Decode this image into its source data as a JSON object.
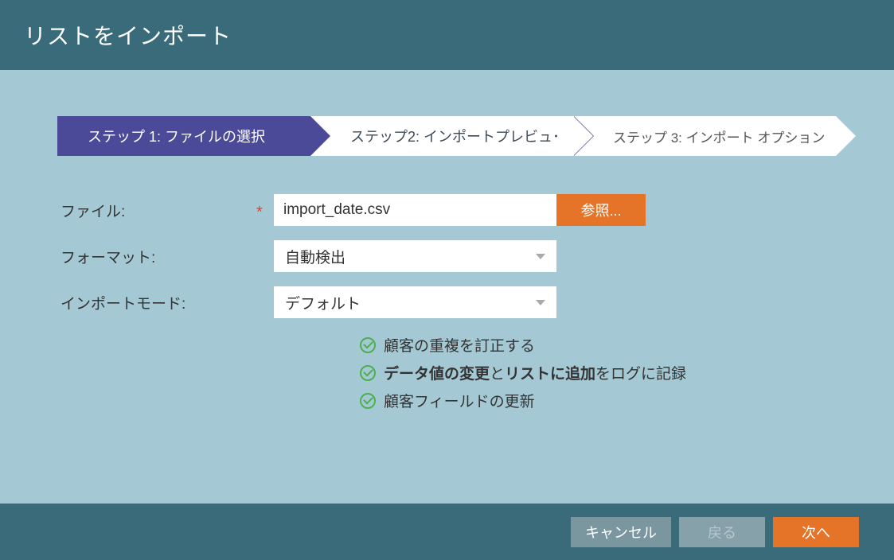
{
  "header": {
    "title": "リストをインポート"
  },
  "wizard": {
    "step1": "ステップ 1: ファイルの選択",
    "step2": "ステップ2: インポートプレビュ･",
    "step3": "ステップ 3: インポート オプション"
  },
  "form": {
    "file_label": "ファイル:",
    "file_value": "import_date.csv",
    "browse_label": "参照...",
    "format_label": "フォーマット:",
    "format_value": "自動検出",
    "mode_label": "インポートモード:",
    "mode_value": "デフォルト"
  },
  "options": {
    "opt1": "顧客の重複を訂正する",
    "opt2_pre": "データ値の変更",
    "opt2_mid": "と",
    "opt2_b2": "リストに追加",
    "opt2_post": "をログに記録",
    "opt3": "顧客フィールドの更新"
  },
  "footer": {
    "cancel": "キャンセル",
    "back": "戻る",
    "next": "次へ"
  }
}
